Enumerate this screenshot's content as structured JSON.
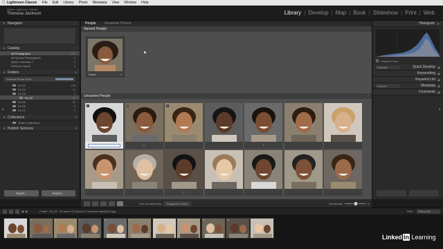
{
  "menubar": {
    "app": "Lightroom Classic",
    "items": [
      "File",
      "Edit",
      "Library",
      "Photo",
      "Metadata",
      "View",
      "Window",
      "Help"
    ]
  },
  "identity": {
    "line1": "Adobe Lightroom Classic",
    "line2": "Theresa Jackson"
  },
  "modules": [
    "Library",
    "Develop",
    "Map",
    "Book",
    "Slideshow",
    "Print",
    "Web"
  ],
  "left": {
    "navigator": "Navigator",
    "catalog": {
      "title": "Catalog",
      "rows": [
        {
          "label": "All Photographs",
          "count": "147"
        },
        {
          "label": "All Synced Photographs",
          "count": "0"
        },
        {
          "label": "Quick Collection +",
          "count": "0"
        },
        {
          "label": "Previous Import",
          "count": "0"
        }
      ]
    },
    "folders": {
      "title": "Folders",
      "drive": "External Photo Drive",
      "rows": [
        {
          "label": "Ch 02",
          "count": "135"
        },
        {
          "label": "Ch 03",
          "count": "11"
        },
        {
          "label": "Ch 04",
          "count": "0"
        },
        {
          "label": "04_02",
          "count": "11"
        },
        {
          "label": "Ch 05",
          "count": "46"
        },
        {
          "label": "Ch 06",
          "count": "0"
        },
        {
          "label": "Ch 07",
          "count": "0"
        }
      ]
    },
    "collections": {
      "title": "Collections",
      "rows": [
        {
          "label": "Smart Collections"
        }
      ]
    },
    "publish": {
      "title": "Publish Services"
    },
    "import_label": "Import...",
    "export_label": "Export..."
  },
  "center": {
    "tabs": [
      "People",
      "Unnamed Person"
    ],
    "named_title": "Named People",
    "named_person": {
      "name": "Kayla",
      "count": "4"
    },
    "unnamed_title": "Unnamed People",
    "cells": [
      {
        "badge": "2",
        "label": ""
      },
      {
        "badge": "2",
        "label": "2"
      },
      {
        "badge": "2",
        "label": ""
      },
      {
        "badge": "",
        "label": ""
      },
      {
        "badge": "",
        "label": "2"
      },
      {
        "badge": "",
        "label": ""
      },
      {
        "badge": "",
        "label": ""
      },
      {
        "badge": "",
        "label": ""
      },
      {
        "badge": "",
        "label": ""
      },
      {
        "badge": "",
        "label": "2"
      },
      {
        "badge": "",
        "label": ""
      },
      {
        "badge": "",
        "label": ""
      },
      {
        "badge": "",
        "label": ""
      },
      {
        "badge": "",
        "label": ""
      }
    ]
  },
  "toolbar": {
    "sort_label": "Sort Unnamed By:",
    "sort_value": "Suggested Name",
    "thumbnails_label": "Thumbnails"
  },
  "right": {
    "histogram": "Histogram",
    "original_photo": "Original Photo",
    "defaults": "Defaults",
    "quick_develop": "Quick Develop",
    "keywording": "Keywording",
    "keyword_list": "Keyword List",
    "default2": "Default",
    "metadata": "Metadata",
    "comments": "Comments"
  },
  "filmstrip": {
    "path": "Folder : 04_02",
    "info": "24 faces /13 photos /1 selected /family034.jpg",
    "filter_label": "Filter :",
    "filter_value": "Filters Off",
    "thumbs": [
      "1",
      "2",
      "3",
      "4",
      "5",
      "6",
      "7",
      "8",
      "9",
      "10",
      "11"
    ]
  },
  "brand": {
    "a": "Linked",
    "b": "In",
    "c": "Learning"
  },
  "colors": {
    "accent": "#e9e9e9",
    "selection": "#6d8bbf",
    "panel": "#2a2a2a",
    "grid": "#4e4e4e"
  }
}
